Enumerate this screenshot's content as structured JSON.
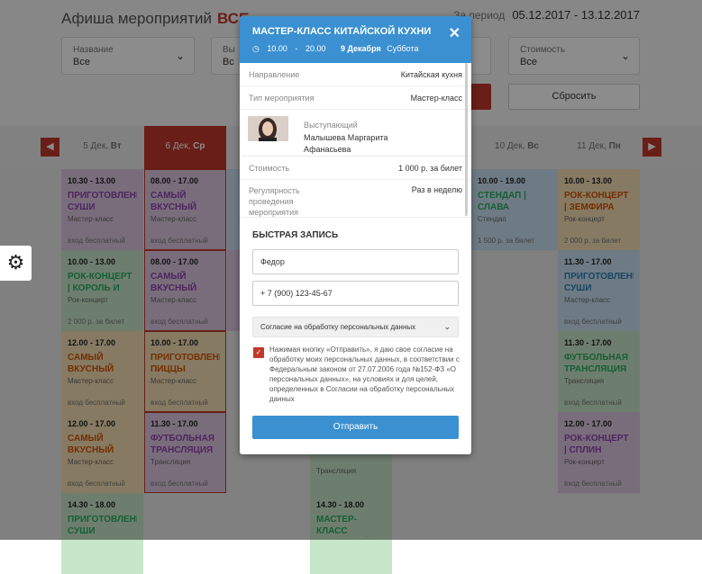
{
  "header": {
    "title": "Афиша мероприятий",
    "all": "ВСЕ",
    "period_label": "За период",
    "period_value": "05.12.2017 - 13.12.2017"
  },
  "filters": {
    "name": {
      "label": "Название",
      "value": "Все"
    },
    "type": {
      "label": "Вы",
      "value": "Вс"
    },
    "cost": {
      "label": "Стоимость",
      "value": "Все"
    }
  },
  "reset_label": "Сбросить",
  "days": [
    {
      "num": "5 Дек,",
      "dow": "Вт"
    },
    {
      "num": "6 Дек,",
      "dow": "Ср"
    },
    {
      "num": "10 Дек,",
      "dow": "Вс"
    },
    {
      "num": "11 Дек,",
      "dow": "Пн"
    }
  ],
  "grid": {
    "c0": [
      {
        "time": "10.30 - 13.00",
        "name": "ПРИГОТОВЛЕНИ СУШИ",
        "kind": "Мастер-класс",
        "price": "вход бесплатный"
      },
      {
        "time": "10.00 - 13.00",
        "name": "РОК-КОНЦЕРТ | КОРОЛЬ И ШУТ",
        "kind": "Рок-концерт",
        "price": "2 000 р. за билет"
      },
      {
        "time": "12.00 - 17.00",
        "name": "САМЫЙ ВКУСНЫЙ",
        "kind": "Мастер-класс",
        "price": "вход бесплатный"
      },
      {
        "time": "12.00 - 17.00",
        "name": "САМЫЙ ВКУСНЫЙ",
        "kind": "Мастер-класс",
        "price": "вход бесплатный"
      },
      {
        "time": "14.30 - 18.00",
        "name": "ПРИГОТОВЛЕНИ СУШИ",
        "kind": "",
        "price": ""
      }
    ],
    "c1": [
      {
        "time": "08.00 - 17.00",
        "name": "САМЫЙ ВКУСНЫЙ",
        "kind": "Мастер-класс",
        "price": "вход бесплатный"
      },
      {
        "time": "08.00 - 17.00",
        "name": "САМЫЙ ВКУСНЫЙ",
        "kind": "Мастер-класс",
        "price": "вход бесплатный"
      },
      {
        "time": "10.00 - 17.00",
        "name": "ПРИГОТОВЛЕНИ ПИЦЦЫ",
        "kind": "Мастер-класс",
        "price": "вход бесплатный"
      },
      {
        "time": "11.30 - 17.00",
        "name": "ФУТБОЛЬНАЯ ТРАНСЛЯЦИЯ",
        "kind": "Трансляция",
        "price": "вход бесплатный"
      }
    ],
    "c4": [
      {
        "time": "10.00 - 19.00",
        "name": "СТЕНДАП | СЛАВА",
        "kind": "Стендап",
        "price": "1 500 р. за билет"
      }
    ],
    "c3": [
      {
        "time": "",
        "name": "",
        "kind": "Трансляция",
        "price": ""
      },
      {
        "time": "14.30 - 18.00",
        "name": "МАСТЕР-КЛАСС КИТАЙСКОЙ",
        "kind": "",
        "price": ""
      }
    ],
    "c5": [
      {
        "time": "10.00 - 13.00",
        "name": "РОК-КОНЦЕРТ | ЗЕМФИРА",
        "kind": "Рок-концерт",
        "price": "2 000 р. за билет"
      },
      {
        "time": "11.30 - 17.00",
        "name": "ПРИГОТОВЛЕНИ СУШИ",
        "kind": "Мастер-класс",
        "price": "вход бесплатный"
      },
      {
        "time": "11.30 - 17.00",
        "name": "ФУТБОЛЬНАЯ ТРАНСЛЯЦИЯ",
        "kind": "Трансляция",
        "price": "вход бесплатный"
      },
      {
        "time": "12.00 - 17.00",
        "name": "РОК-КОНЦЕРТ | СПЛИН",
        "kind": "Рок-концерт",
        "price": "вход бесплатный"
      }
    ]
  },
  "modal": {
    "title": "МАСТЕР-КЛАСС КИТАЙСКОЙ КУХНИ",
    "time_from": "10.00",
    "time_sep": "-",
    "time_to": "20.00",
    "date": "9 Декабря",
    "weekday": "Суббота",
    "rows": [
      {
        "label": "Направление",
        "value": "Китайская кухня"
      },
      {
        "label": "Тип мероприятия",
        "value": "Мастер-класс"
      },
      {
        "label": "Стоимость",
        "value": "1 000 р. за билет"
      },
      {
        "label": "Регулярность проведения мероприятия",
        "value": "Раз в неделю"
      }
    ],
    "performer_label": "Выступающий",
    "performer_name": "Малышева Маргарита Афанасьева",
    "quick_title": "БЫСТРАЯ ЗАПИСЬ",
    "name_value": "Федор",
    "phone_value": "+ 7 (900) 123-45-67",
    "consent_select": "Согласие на обработку персональных данных",
    "consent_text": "Нажимая кнопку «Отправить», я даю свое согласие на обработку моих персональных данных, в соответствии с Федеральным законом от 27.07.2006 года №152-ФЗ «О персональных данных», на условиях и для целей, определенных в Согласии на обработку персональных данных",
    "submit": "Отправить"
  },
  "colors": {
    "accent": "#c0392b",
    "primary": "#3a90d0"
  }
}
